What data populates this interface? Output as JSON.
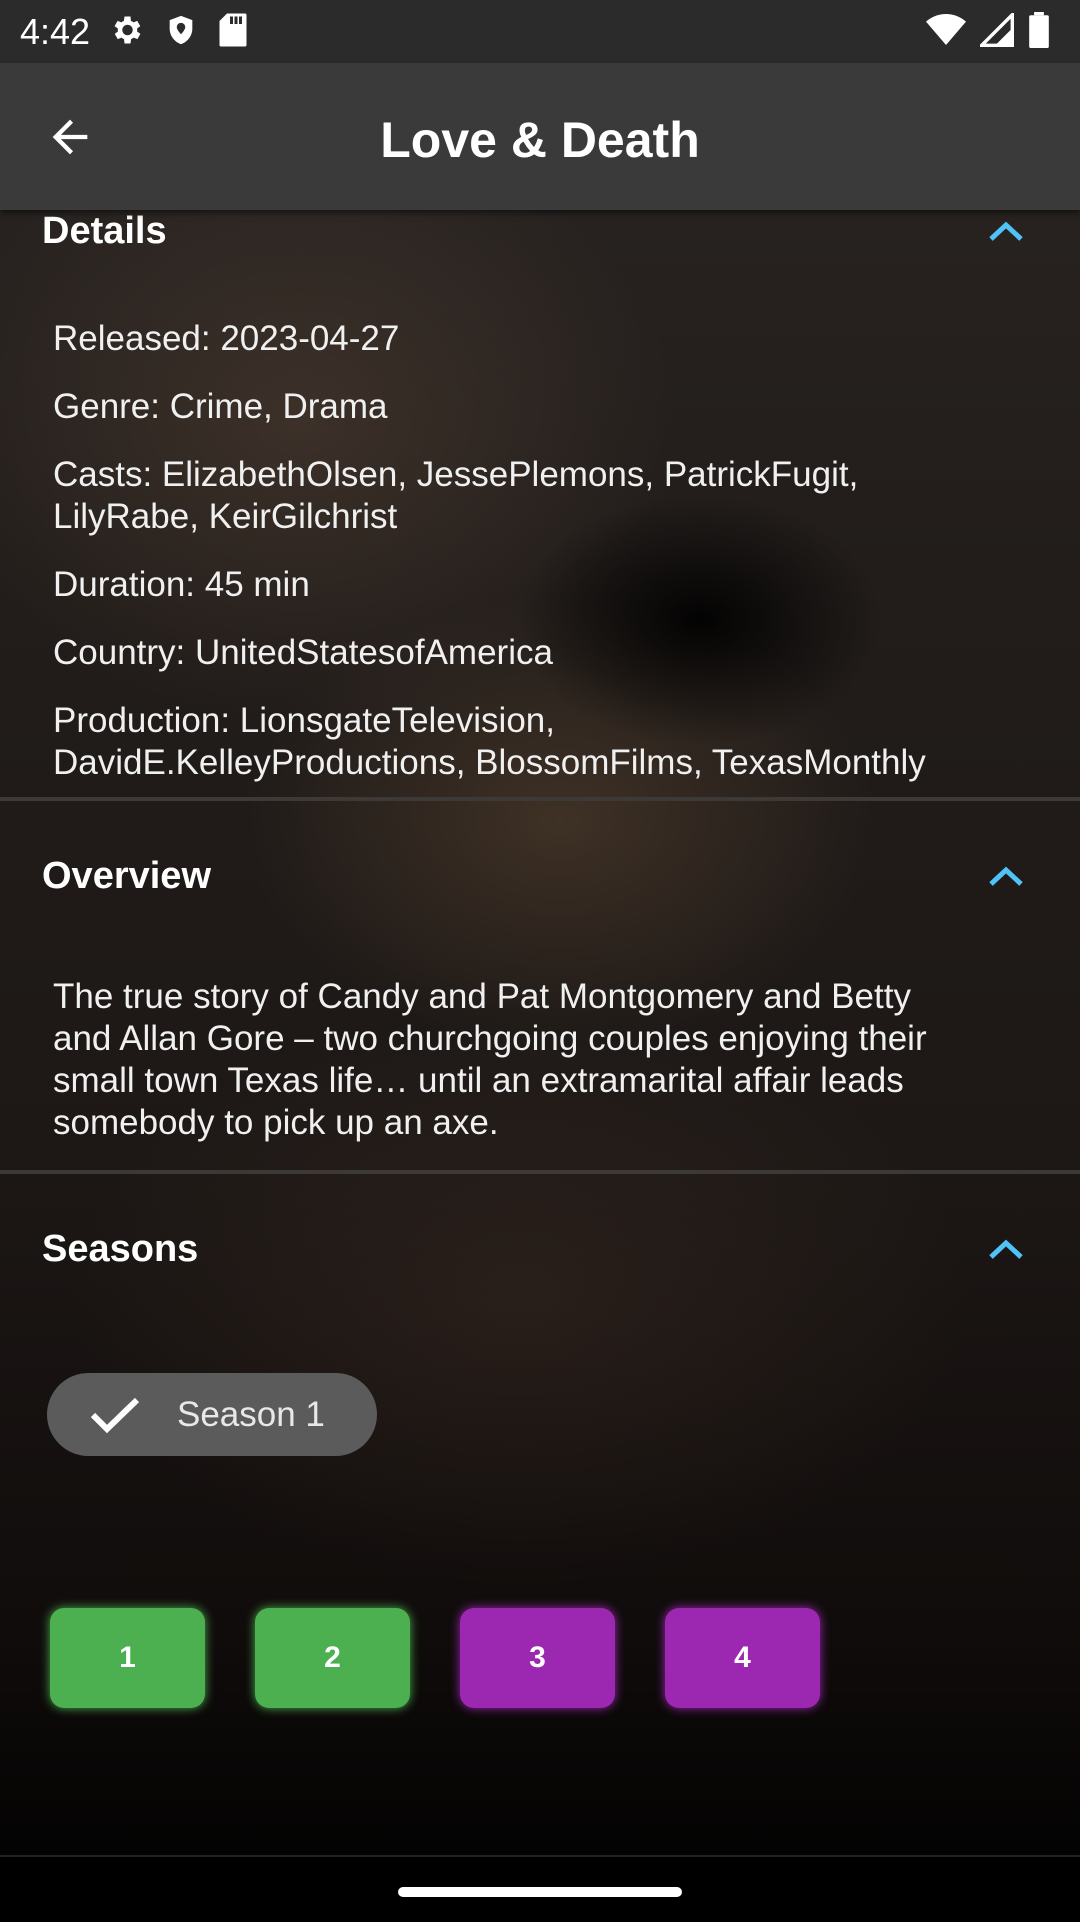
{
  "status_bar": {
    "time": "4:42",
    "icons_left": [
      "gear-icon",
      "shield-icon",
      "sd-card-icon"
    ],
    "icons_right": [
      "wifi-icon",
      "signal-icon",
      "battery-icon"
    ]
  },
  "app_bar": {
    "title": "Love & Death",
    "back_icon": "arrow-left-icon"
  },
  "sections": {
    "details": {
      "title": "Details",
      "released": "Released: 2023-04-27",
      "genre": "Genre: Crime, Drama",
      "casts_line1": "Casts: ElizabethOlsen, JessePlemons, PatrickFugit,",
      "casts_line2": "LilyRabe, KeirGilchrist",
      "duration": "Duration: 45 min",
      "country": "Country: UnitedStatesofAmerica",
      "production_line1": "Production: LionsgateTelevision,",
      "production_line2": "DavidE.KelleyProductions, BlossomFilms, TexasMonthly"
    },
    "overview": {
      "title": "Overview",
      "line1": "The true story of Candy and Pat Montgomery and Betty",
      "line2": "and Allan Gore – two churchgoing couples enjoying their",
      "line3": "small town Texas life… until an extramarital affair leads",
      "line4": "somebody to pick up an axe."
    },
    "seasons": {
      "title": "Seasons",
      "selected_season": "Season 1",
      "episodes": [
        {
          "label": "1",
          "color": "#4caf50"
        },
        {
          "label": "2",
          "color": "#4caf50"
        },
        {
          "label": "3",
          "color": "#9c27b0"
        },
        {
          "label": "4",
          "color": "#9c27b0"
        }
      ]
    }
  },
  "colors": {
    "accent": "#4fc3f7",
    "watched": "#4caf50",
    "unwatched": "#9c27b0"
  }
}
